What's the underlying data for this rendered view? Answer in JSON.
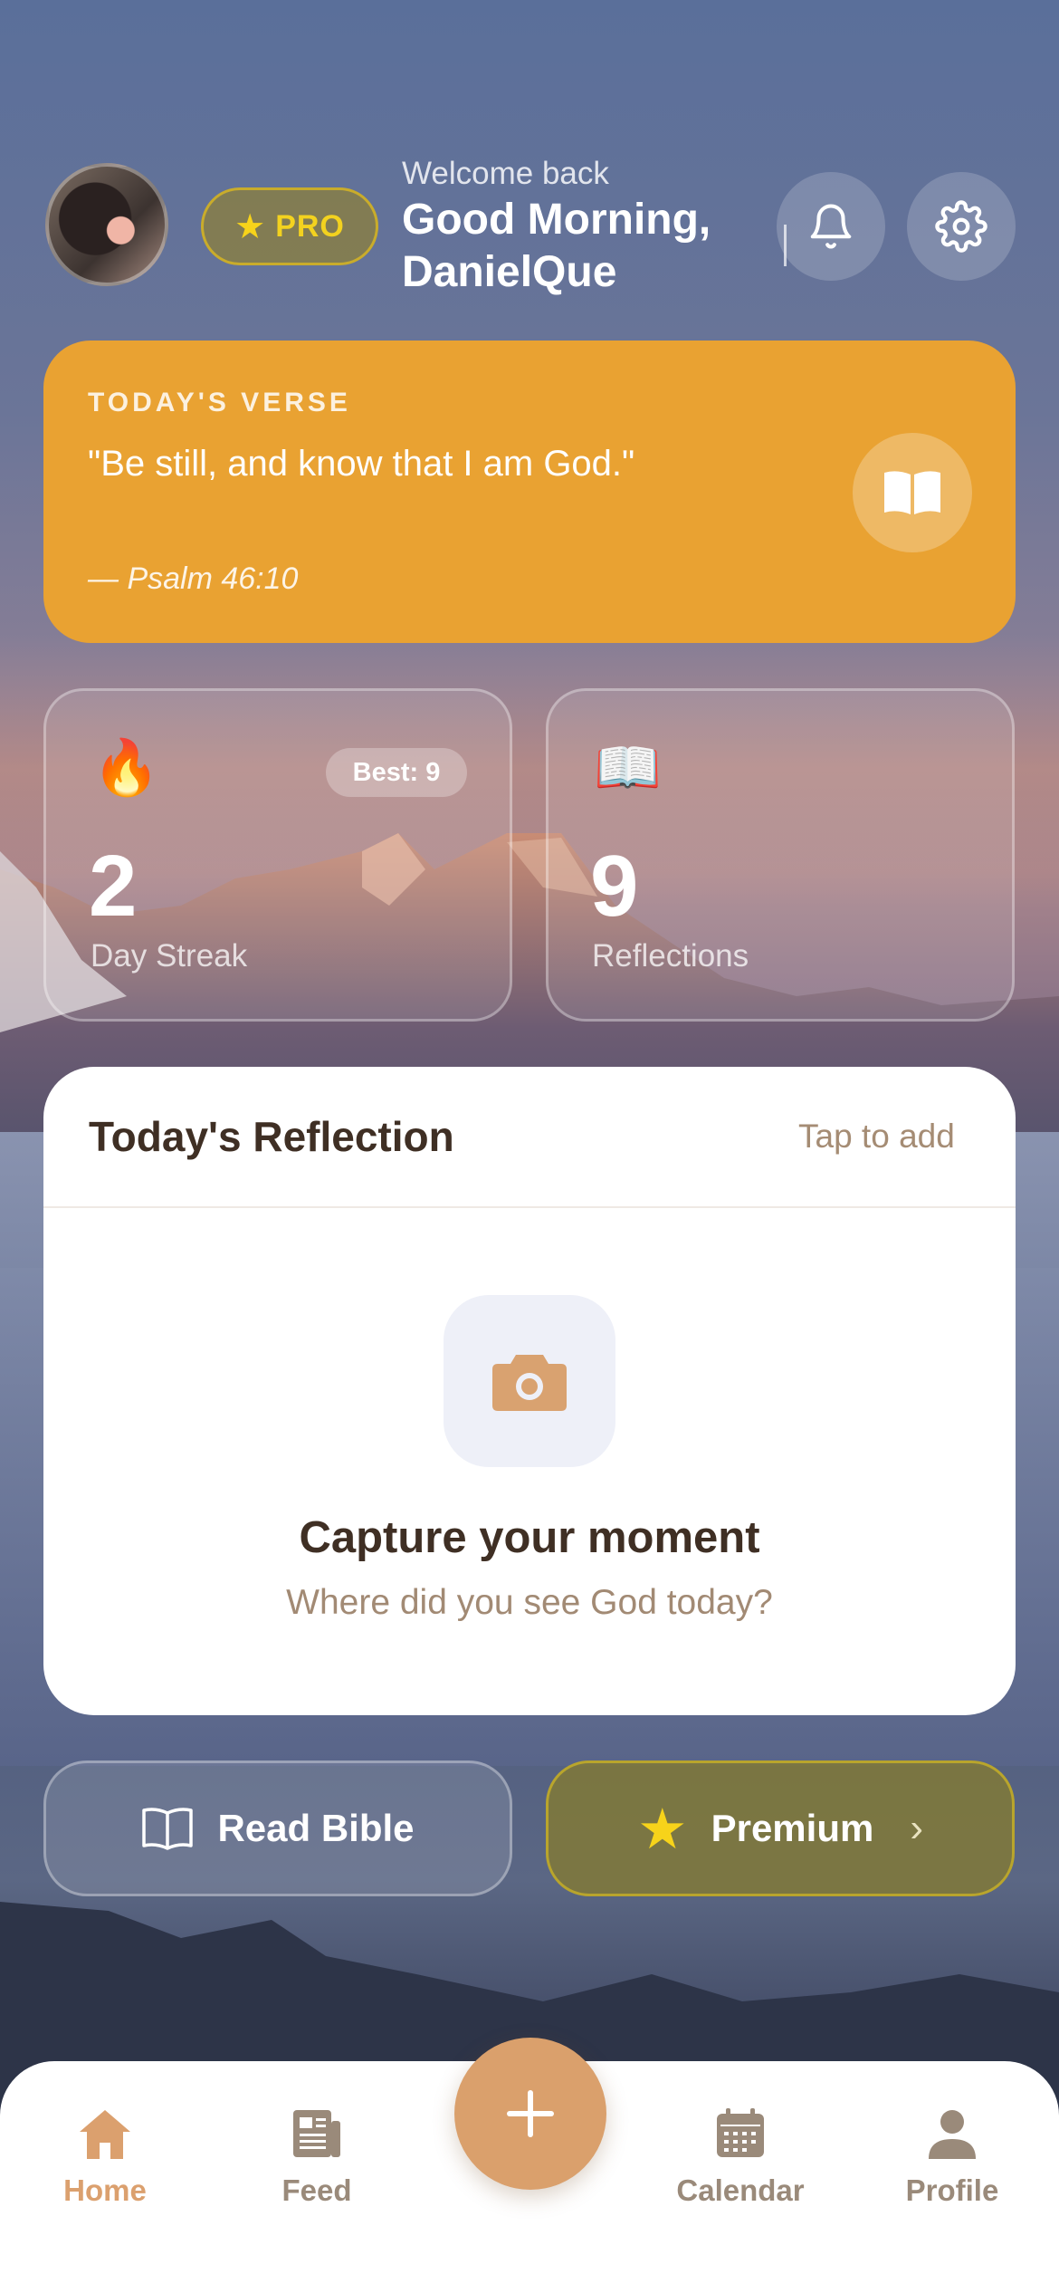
{
  "header": {
    "pro_badge": "PRO",
    "welcome": "Welcome back",
    "greeting": "Good Morning,",
    "username": "DanielQue"
  },
  "verse": {
    "tag": "TODAY'S VERSE",
    "text": "\"Be still, and know that I am God.\"",
    "reference": "— Psalm 46:10"
  },
  "stats": {
    "streak": {
      "emoji": "🔥",
      "best": "Best: 9",
      "value": "2",
      "label": "Day Streak"
    },
    "reflections": {
      "emoji": "📖",
      "value": "9",
      "label": "Reflections"
    }
  },
  "reflection": {
    "title": "Today's Reflection",
    "tap_label": "Tap to add",
    "capture_title": "Capture your moment",
    "capture_subtitle": "Where did you see God today?"
  },
  "actions": {
    "read_bible": "Read Bible",
    "premium": "Premium"
  },
  "tabs": [
    {
      "label": "Home",
      "icon": "home-icon",
      "active": true
    },
    {
      "label": "Feed",
      "icon": "newspaper-icon",
      "active": false
    },
    {
      "label": "Calendar",
      "icon": "calendar-icon",
      "active": false
    },
    {
      "label": "Profile",
      "icon": "person-icon",
      "active": false
    }
  ],
  "colors": {
    "verse_card": "#e9a232",
    "accent": "#daa06c",
    "pro_gold": "#f3d21f"
  }
}
